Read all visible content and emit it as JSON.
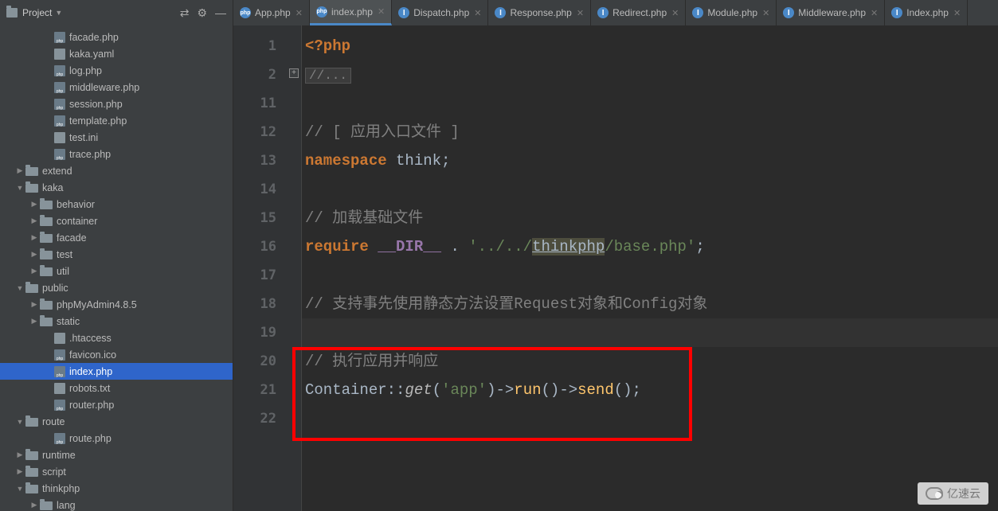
{
  "project": {
    "title": "Project"
  },
  "tabs": [
    {
      "label": "App.php",
      "icon": "php",
      "active": false
    },
    {
      "label": "index.php",
      "icon": "php",
      "active": true
    },
    {
      "label": "Dispatch.php",
      "icon": "int",
      "active": false
    },
    {
      "label": "Response.php",
      "icon": "int",
      "active": false
    },
    {
      "label": "Redirect.php",
      "icon": "int",
      "active": false
    },
    {
      "label": "Module.php",
      "icon": "int",
      "active": false
    },
    {
      "label": "Middleware.php",
      "icon": "int",
      "active": false
    },
    {
      "label": "Index.php",
      "icon": "int",
      "active": false
    }
  ],
  "tree": [
    {
      "indent": 3,
      "icon": "php",
      "label": "facade.php"
    },
    {
      "indent": 3,
      "icon": "file",
      "label": "kaka.yaml"
    },
    {
      "indent": 3,
      "icon": "php",
      "label": "log.php"
    },
    {
      "indent": 3,
      "icon": "php",
      "label": "middleware.php"
    },
    {
      "indent": 3,
      "icon": "php",
      "label": "session.php"
    },
    {
      "indent": 3,
      "icon": "php",
      "label": "template.php"
    },
    {
      "indent": 3,
      "icon": "file",
      "label": "test.ini"
    },
    {
      "indent": 3,
      "icon": "php",
      "label": "trace.php"
    },
    {
      "indent": 1,
      "arrow": "▶",
      "icon": "folder",
      "label": "extend"
    },
    {
      "indent": 1,
      "arrow": "▼",
      "icon": "folder",
      "label": "kaka"
    },
    {
      "indent": 2,
      "arrow": "▶",
      "icon": "folder",
      "label": "behavior"
    },
    {
      "indent": 2,
      "arrow": "▶",
      "icon": "folder",
      "label": "container"
    },
    {
      "indent": 2,
      "arrow": "▶",
      "icon": "folder",
      "label": "facade"
    },
    {
      "indent": 2,
      "arrow": "▶",
      "icon": "folder",
      "label": "test"
    },
    {
      "indent": 2,
      "arrow": "▶",
      "icon": "folder",
      "label": "util"
    },
    {
      "indent": 1,
      "arrow": "▼",
      "icon": "folder",
      "label": "public"
    },
    {
      "indent": 2,
      "arrow": "▶",
      "icon": "folder",
      "label": "phpMyAdmin4.8.5"
    },
    {
      "indent": 2,
      "arrow": "▶",
      "icon": "folder",
      "label": "static"
    },
    {
      "indent": 3,
      "icon": "file",
      "label": ".htaccess"
    },
    {
      "indent": 3,
      "icon": "php",
      "label": "favicon.ico"
    },
    {
      "indent": 3,
      "icon": "php",
      "label": "index.php",
      "selected": true
    },
    {
      "indent": 3,
      "icon": "file",
      "label": "robots.txt"
    },
    {
      "indent": 3,
      "icon": "php",
      "label": "router.php"
    },
    {
      "indent": 1,
      "arrow": "▼",
      "icon": "folder",
      "label": "route"
    },
    {
      "indent": 3,
      "icon": "php",
      "label": "route.php"
    },
    {
      "indent": 1,
      "arrow": "▶",
      "icon": "folder",
      "label": "runtime"
    },
    {
      "indent": 1,
      "arrow": "▶",
      "icon": "folder",
      "label": "script"
    },
    {
      "indent": 1,
      "arrow": "▼",
      "icon": "folder",
      "label": "thinkphp"
    },
    {
      "indent": 2,
      "arrow": "▶",
      "icon": "folder",
      "label": "lang"
    }
  ],
  "lines": [
    "1",
    "2",
    "11",
    "12",
    "13",
    "14",
    "15",
    "16",
    "17",
    "18",
    "19",
    "20",
    "21",
    "22"
  ],
  "code": {
    "l1_tag": "<?php",
    "l2_fold": "//...",
    "l12_c": "// [ 应用入口文件 ]",
    "l13_kw": "namespace ",
    "l13_id": "think",
    "l13_semi": ";",
    "l15_c": "// 加载基础文件",
    "l16_kw": "require ",
    "l16_const": "__DIR__",
    "l16_dot": " . ",
    "l16_s1": "'../../",
    "l16_link": "thinkphp",
    "l16_s2": "/base.php'",
    "l16_semi": ";",
    "l18_c": "// 支持事先使用静态方法设置Request对象和Config对象",
    "l20_c": "// 执行应用并响应",
    "l21_cls": "Container",
    "l21_op1": "::",
    "l21_get": "get",
    "l21_p1": "(",
    "l21_sapp": "'app'",
    "l21_p2": ")->",
    "l21_run": "run",
    "l21_p3": "()->",
    "l21_send": "send",
    "l21_p4": "();"
  },
  "watermark": "亿速云"
}
